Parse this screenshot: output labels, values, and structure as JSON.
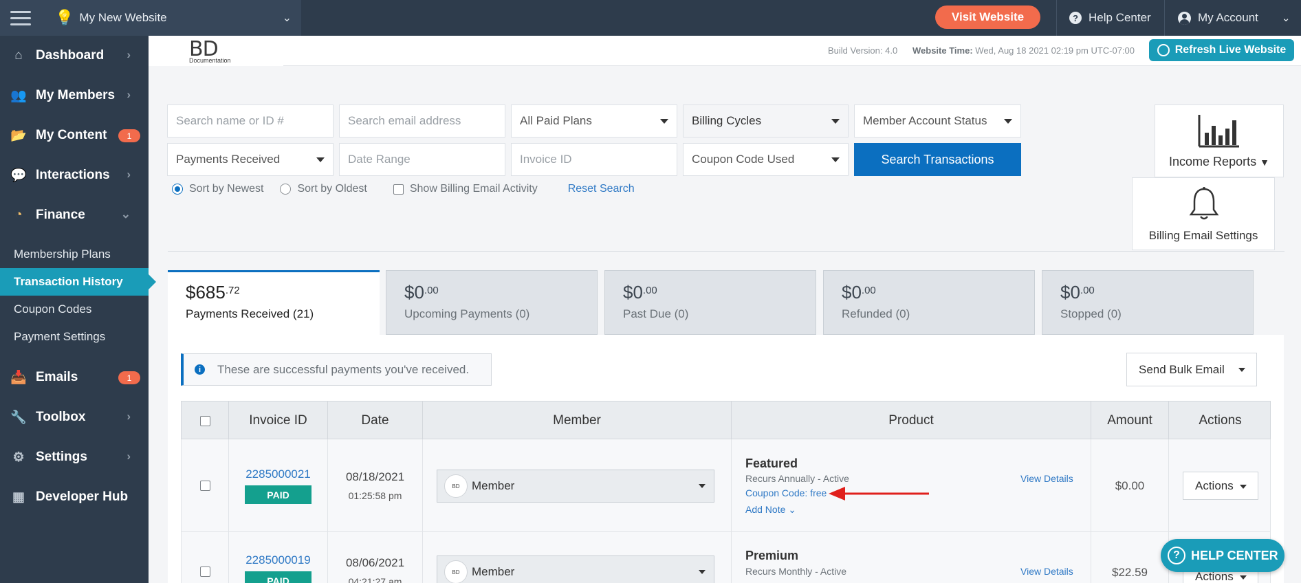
{
  "topbar": {
    "site_name": "My New Website",
    "visit_label": "Visit Website",
    "help_label": "Help Center",
    "account_label": "My Account",
    "colors": {
      "bar": "#2e3c4c",
      "accent": "#f26b4c"
    }
  },
  "sidebar": {
    "items": [
      {
        "label": "Dashboard",
        "icon": "home-icon"
      },
      {
        "label": "My Members",
        "icon": "users-icon"
      },
      {
        "label": "My Content",
        "icon": "folder-icon",
        "badge": "1"
      },
      {
        "label": "Interactions",
        "icon": "chat-icon"
      },
      {
        "label": "Finance",
        "icon": "pie-chart-icon",
        "expanded": true
      },
      {
        "label": "Emails",
        "icon": "inbox-icon",
        "badge": "1"
      },
      {
        "label": "Toolbox",
        "icon": "wrench-icon"
      },
      {
        "label": "Settings",
        "icon": "gear-icon"
      },
      {
        "label": "Developer Hub",
        "icon": "grid-icon"
      }
    ],
    "finance_sub": [
      {
        "label": "Membership Plans"
      },
      {
        "label": "Transaction History",
        "active": true
      },
      {
        "label": "Coupon Codes"
      },
      {
        "label": "Payment Settings"
      }
    ]
  },
  "header": {
    "logo_text": "BD",
    "logo_sub": "Documentation",
    "build_version": "Build Version: 4.0",
    "website_time_label": "Website Time:",
    "website_time_value": "Wed, Aug 18 2021 02:19 pm UTC-07:00",
    "refresh_label": "Refresh Live Website"
  },
  "filters": {
    "search_name_placeholder": "Search name or ID #",
    "search_email_placeholder": "Search email address",
    "plans_select": "All Paid Plans",
    "billing_cycles": "Billing Cycles",
    "account_status": "Member Account Status",
    "payments_received": "Payments Received",
    "date_range_placeholder": "Date Range",
    "invoice_id_placeholder": "Invoice ID",
    "coupon_select": "Coupon Code Used",
    "search_button": "Search Transactions",
    "sort_newest": "Sort by Newest",
    "sort_oldest": "Sort by Oldest",
    "show_billing": "Show Billing Email Activity",
    "reset": "Reset Search"
  },
  "side_boxes": {
    "income_reports": "Income Reports",
    "billing_email": "Billing Email Settings"
  },
  "tabs": [
    {
      "amount": "$685",
      "cents": ".72",
      "label": "Payments Received (21)",
      "active": true
    },
    {
      "amount": "$0",
      "cents": ".00",
      "label": "Upcoming Payments (0)"
    },
    {
      "amount": "$0",
      "cents": ".00",
      "label": "Past Due (0)"
    },
    {
      "amount": "$0",
      "cents": ".00",
      "label": "Refunded (0)"
    },
    {
      "amount": "$0",
      "cents": ".00",
      "label": "Stopped (0)"
    }
  ],
  "info_message": "These are successful payments you've received.",
  "bulk_email_label": "Send Bulk Email",
  "table": {
    "headers": [
      "Invoice ID",
      "Date",
      "Member",
      "Product",
      "Amount",
      "Actions"
    ],
    "rows": [
      {
        "invoice": "2285000021",
        "status": "PAID",
        "date": "08/18/2021",
        "time": "01:25:58 pm",
        "member": "Member",
        "product": "Featured",
        "recurrence": "Recurs Annually - Active",
        "coupon": "Coupon Code: free",
        "add_note": "Add Note ⌄",
        "view_details": "View Details",
        "amount": "$0.00",
        "actions": "Actions"
      },
      {
        "invoice": "2285000019",
        "status": "PAID",
        "date": "08/06/2021",
        "time": "04:21:27 am",
        "member": "Member",
        "product": "Premium",
        "recurrence": "Recurs Monthly - Active",
        "view_details": "View Details",
        "amount": "$22.59",
        "actions": "Actions"
      }
    ]
  },
  "help_float": "HELP CENTER"
}
